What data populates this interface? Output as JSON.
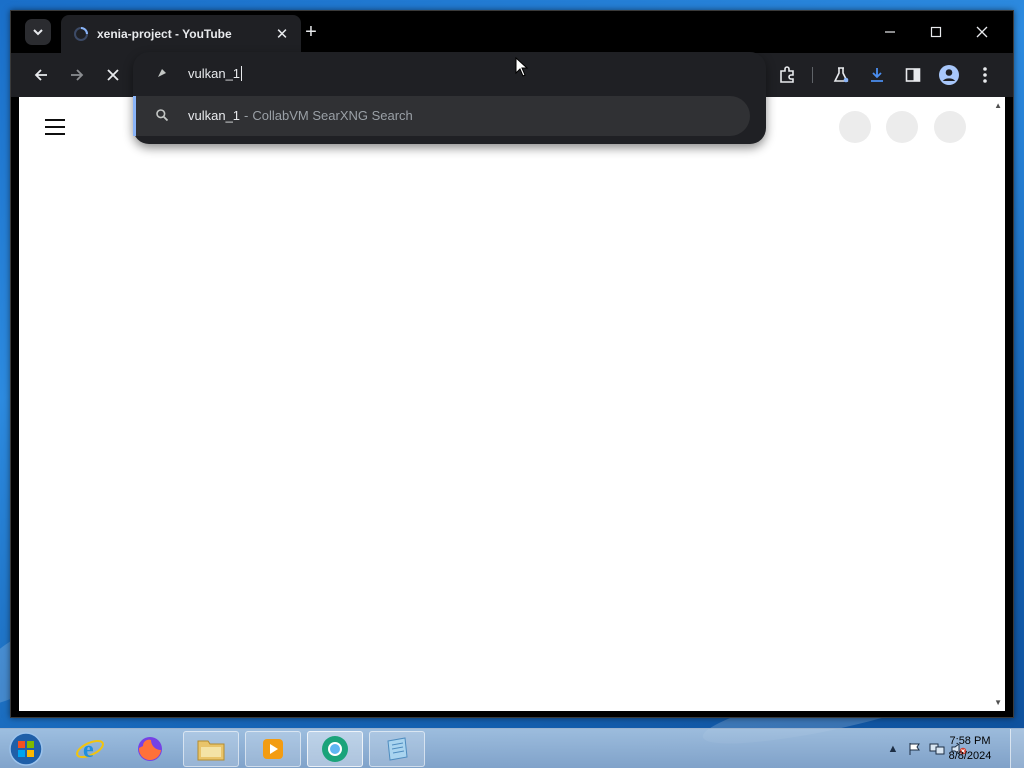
{
  "browser": {
    "tab": {
      "title": "xenia-project - YouTube"
    },
    "window_controls": {
      "minimize": "─",
      "maximize": "☐",
      "close": "✕"
    },
    "new_tab_symbol": "+",
    "tab_close_symbol": "✕"
  },
  "omnibox": {
    "typed_text": "vulkan_1",
    "suggestions": [
      {
        "query": "vulkan_1",
        "separator": "-",
        "engine": "CollabVM SearXNG Search"
      }
    ]
  },
  "taskbar": {
    "clock": {
      "time": "7:58 PM",
      "date": "8/8/2024"
    }
  }
}
